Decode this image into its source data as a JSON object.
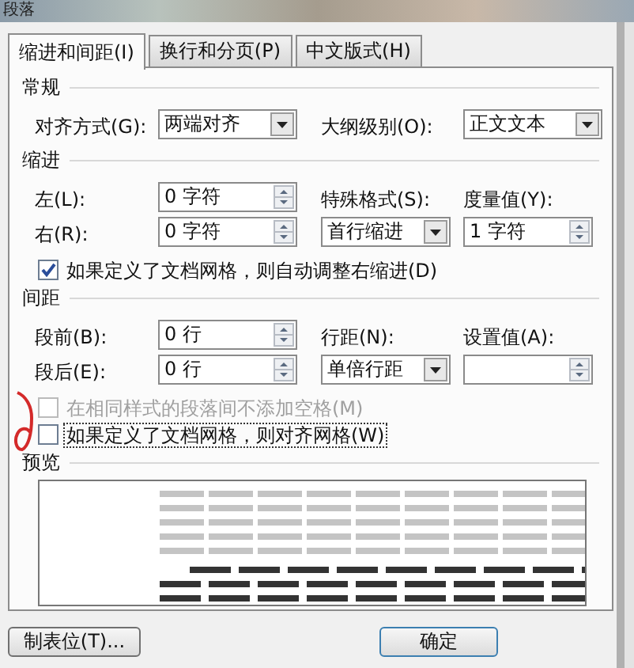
{
  "window": {
    "title": "段落"
  },
  "tabs": [
    {
      "label": "缩进和间距(I)",
      "selected": true
    },
    {
      "label": "换行和分页(P)",
      "selected": false
    },
    {
      "label": "中文版式(H)",
      "selected": false
    }
  ],
  "general": {
    "heading": "常规",
    "rows": [
      [
        {
          "kind": "label",
          "text": "对齐方式(G):"
        },
        {
          "kind": "select",
          "value": "两端对齐"
        },
        {
          "kind": "label",
          "text": "大纲级别(O):"
        },
        {
          "kind": "select",
          "value": "正文文本"
        }
      ]
    ]
  },
  "indentation": {
    "heading": "缩进",
    "rows": [
      [
        {
          "kind": "label",
          "text": "左(L):"
        },
        {
          "kind": "spin",
          "value": "0 字符"
        },
        {
          "kind": "label",
          "text": "特殊格式(S):"
        },
        {
          "kind": "label",
          "text": "度量值(Y):"
        }
      ],
      [
        {
          "kind": "label",
          "text": "右(R):"
        },
        {
          "kind": "spin",
          "value": "0 字符"
        },
        {
          "kind": "select",
          "value": "首行缩进"
        },
        {
          "kind": "spin",
          "value": "1 字符"
        }
      ]
    ],
    "checkboxes": [
      {
        "label": "如果定义了文档网格，则自动调整右缩进(D)",
        "checked": true,
        "disabled": false,
        "focused": false
      }
    ]
  },
  "spacing": {
    "heading": "间距",
    "rows": [
      [
        {
          "kind": "label",
          "text": "段前(B):"
        },
        {
          "kind": "spin",
          "value": "0 行"
        },
        {
          "kind": "label",
          "text": "行距(N):"
        },
        {
          "kind": "label",
          "text": "设置值(A):"
        }
      ],
      [
        {
          "kind": "label",
          "text": "段后(E):"
        },
        {
          "kind": "spin",
          "value": "0 行"
        },
        {
          "kind": "select",
          "value": "单倍行距"
        },
        {
          "kind": "spin"
        }
      ]
    ],
    "checkboxes": [
      {
        "label": "在相同样式的段落间不添加空格(M)",
        "checked": false,
        "disabled": true,
        "focused": false
      },
      {
        "label": "如果定义了文档网格，则对齐网格(W)",
        "checked": false,
        "disabled": false,
        "focused": true
      }
    ]
  },
  "preview": {
    "heading": "预览"
  },
  "buttons": [
    {
      "label": "制表位(T)..."
    },
    {
      "label": "确定"
    }
  ]
}
